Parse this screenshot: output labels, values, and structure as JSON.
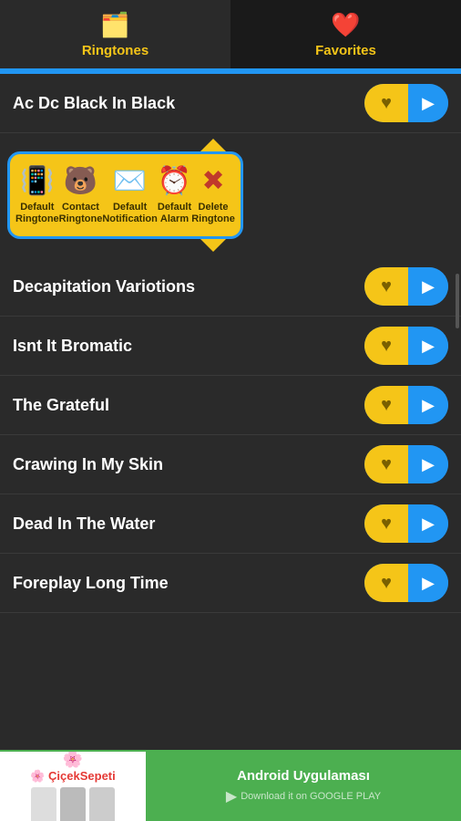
{
  "tabs": [
    {
      "id": "ringtones",
      "label": "Ringtones",
      "icon": "🗂️",
      "active": true
    },
    {
      "id": "favorites",
      "label": "Favorites",
      "icon": "❤️",
      "active": false
    }
  ],
  "songs": [
    {
      "id": 1,
      "title": "Ac Dc Black In Black",
      "expanded": true
    },
    {
      "id": 2,
      "title": "Decapitation Variotions",
      "expanded": false
    },
    {
      "id": 3,
      "title": "Isnt It Bromatic",
      "expanded": false
    },
    {
      "id": 4,
      "title": "The Grateful",
      "expanded": false
    },
    {
      "id": 5,
      "title": "Crawing In My Skin",
      "expanded": false
    },
    {
      "id": 6,
      "title": "Dead In The Water",
      "expanded": false
    },
    {
      "id": 7,
      "title": "Foreplay Long Time",
      "expanded": false
    }
  ],
  "popup": {
    "actions": [
      {
        "id": "default-ringtone",
        "icon": "📳",
        "label": "Default\nRingtone"
      },
      {
        "id": "contact-ringtone",
        "icon": "🐻",
        "label": "Contact\nRingtone"
      },
      {
        "id": "default-notification",
        "icon": "✉️",
        "label": "Default\nNotification"
      },
      {
        "id": "default-alarm",
        "icon": "⏰",
        "label": "Default\nAlarm"
      },
      {
        "id": "delete-ringtone",
        "icon": "✖️",
        "label": "Delete\nRingtone"
      }
    ]
  },
  "ad": {
    "logo": "🌸 ÇiçekSepeti",
    "title": "Android Uygulaması",
    "subtitle": "Download it on GOOGLE PLAY"
  }
}
